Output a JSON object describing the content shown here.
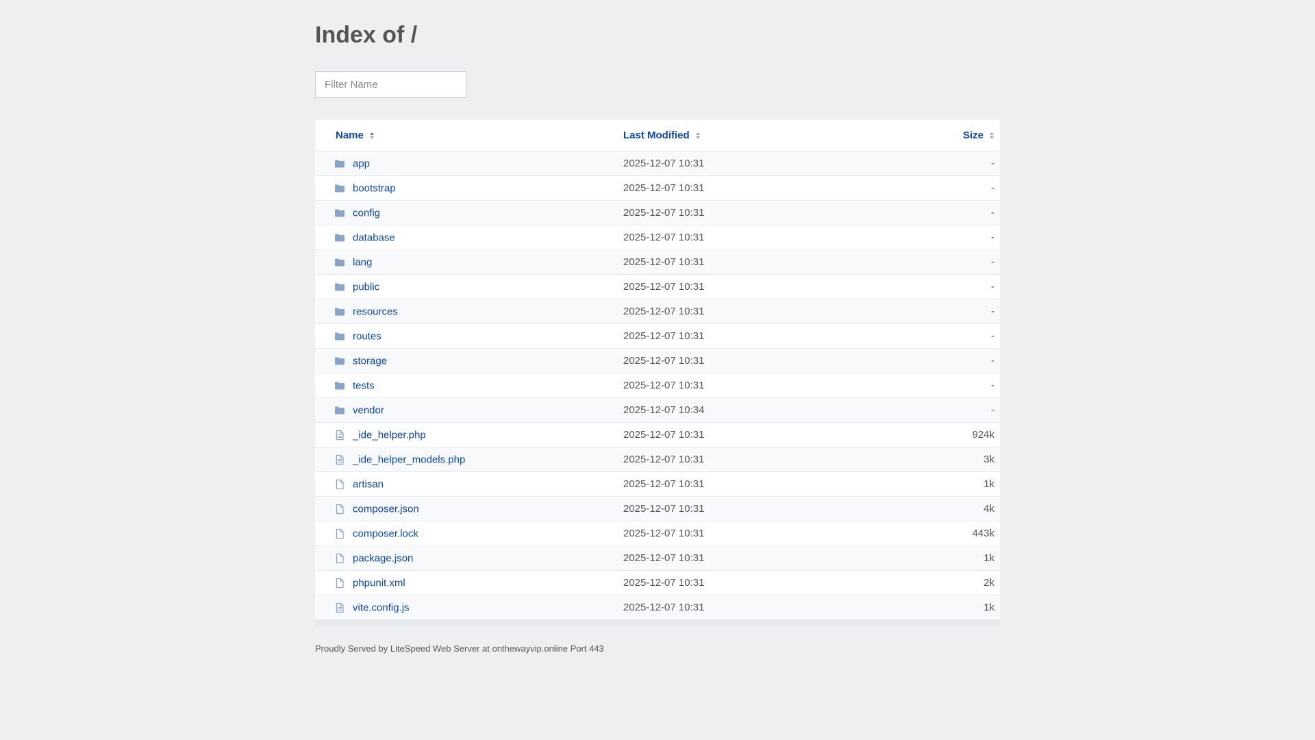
{
  "page": {
    "title": "Index of /",
    "filter_placeholder": "Filter Name",
    "footer": "Proudly Served by LiteSpeed Web Server at onthewayvip.online Port 443"
  },
  "table": {
    "headers": {
      "name": "Name",
      "modified": "Last Modified",
      "size": "Size"
    },
    "rows": [
      {
        "name": "app",
        "modified": "2025-12-07 10:31",
        "size": "-",
        "icon": "folder-icon"
      },
      {
        "name": "bootstrap",
        "modified": "2025-12-07 10:31",
        "size": "-",
        "icon": "folder-icon"
      },
      {
        "name": "config",
        "modified": "2025-12-07 10:31",
        "size": "-",
        "icon": "folder-icon"
      },
      {
        "name": "database",
        "modified": "2025-12-07 10:31",
        "size": "-",
        "icon": "folder-icon"
      },
      {
        "name": "lang",
        "modified": "2025-12-07 10:31",
        "size": "-",
        "icon": "folder-icon"
      },
      {
        "name": "public",
        "modified": "2025-12-07 10:31",
        "size": "-",
        "icon": "folder-icon"
      },
      {
        "name": "resources",
        "modified": "2025-12-07 10:31",
        "size": "-",
        "icon": "folder-icon"
      },
      {
        "name": "routes",
        "modified": "2025-12-07 10:31",
        "size": "-",
        "icon": "folder-icon"
      },
      {
        "name": "storage",
        "modified": "2025-12-07 10:31",
        "size": "-",
        "icon": "folder-icon"
      },
      {
        "name": "tests",
        "modified": "2025-12-07 10:31",
        "size": "-",
        "icon": "folder-icon"
      },
      {
        "name": "vendor",
        "modified": "2025-12-07 10:34",
        "size": "-",
        "icon": "folder-icon"
      },
      {
        "name": "_ide_helper.php",
        "modified": "2025-12-07 10:31",
        "size": "924k",
        "icon": "text-file-icon"
      },
      {
        "name": "_ide_helper_models.php",
        "modified": "2025-12-07 10:31",
        "size": "3k",
        "icon": "text-file-icon"
      },
      {
        "name": "artisan",
        "modified": "2025-12-07 10:31",
        "size": "1k",
        "icon": "file-icon"
      },
      {
        "name": "composer.json",
        "modified": "2025-12-07 10:31",
        "size": "4k",
        "icon": "file-icon"
      },
      {
        "name": "composer.lock",
        "modified": "2025-12-07 10:31",
        "size": "443k",
        "icon": "file-icon"
      },
      {
        "name": "package.json",
        "modified": "2025-12-07 10:31",
        "size": "1k",
        "icon": "file-icon"
      },
      {
        "name": "phpunit.xml",
        "modified": "2025-12-07 10:31",
        "size": "2k",
        "icon": "file-icon"
      },
      {
        "name": "vite.config.js",
        "modified": "2025-12-07 10:31",
        "size": "1k",
        "icon": "text-file-icon"
      }
    ]
  },
  "colors": {
    "link": "#0d47a1",
    "icon": "#8aa4c8",
    "background": "#eeeff1"
  }
}
